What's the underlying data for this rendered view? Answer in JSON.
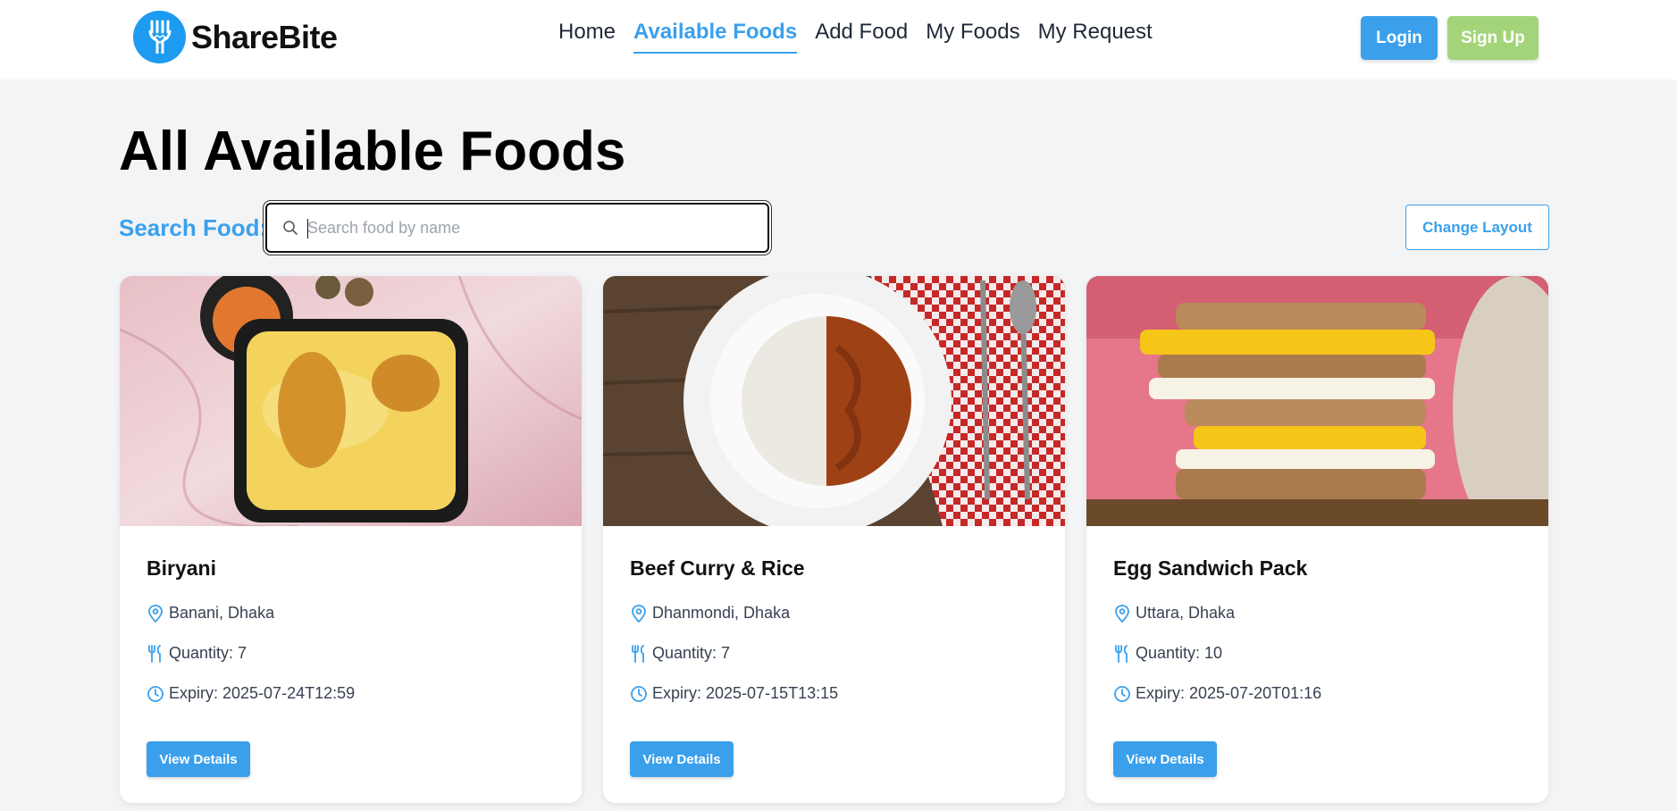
{
  "brand": {
    "name": "ShareBite",
    "accent": "#3aa0ec",
    "logo_color": "#1d9bf0"
  },
  "nav": {
    "items": [
      {
        "label": "Home",
        "active": false
      },
      {
        "label": "Available Foods",
        "active": true
      },
      {
        "label": "Add Food",
        "active": false
      },
      {
        "label": "My Foods",
        "active": false
      },
      {
        "label": "My Request",
        "active": false
      }
    ],
    "login_label": "Login",
    "signup_label": "Sign Up",
    "signup_color": "#a3d47a"
  },
  "main": {
    "title": "All Available Foods",
    "search": {
      "label": "Search Food:",
      "placeholder": "Search food by name",
      "value": ""
    },
    "change_layout_label": "Change Layout"
  },
  "foods": [
    {
      "name": "Biryani",
      "location": "Banani, Dhaka",
      "quantity": "Quantity: 7",
      "expiry": "Expiry: 2025-07-24T12:59",
      "button_label": "View Details",
      "image": "biryani-photo"
    },
    {
      "name": "Beef Curry & Rice",
      "location": "Dhanmondi, Dhaka",
      "quantity": "Quantity: 7",
      "expiry": "Expiry: 2025-07-15T13:15",
      "button_label": "View Details",
      "image": "beef-curry-rice-photo"
    },
    {
      "name": "Egg Sandwich Pack",
      "location": "Uttara, Dhaka",
      "quantity": "Quantity: 10",
      "expiry": "Expiry: 2025-07-20T01:16",
      "button_label": "View Details",
      "image": "egg-sandwich-photo"
    }
  ],
  "icons": {
    "location": "map-pin-icon",
    "quantity": "utensils-icon",
    "expiry": "clock-icon",
    "search": "search-icon"
  }
}
